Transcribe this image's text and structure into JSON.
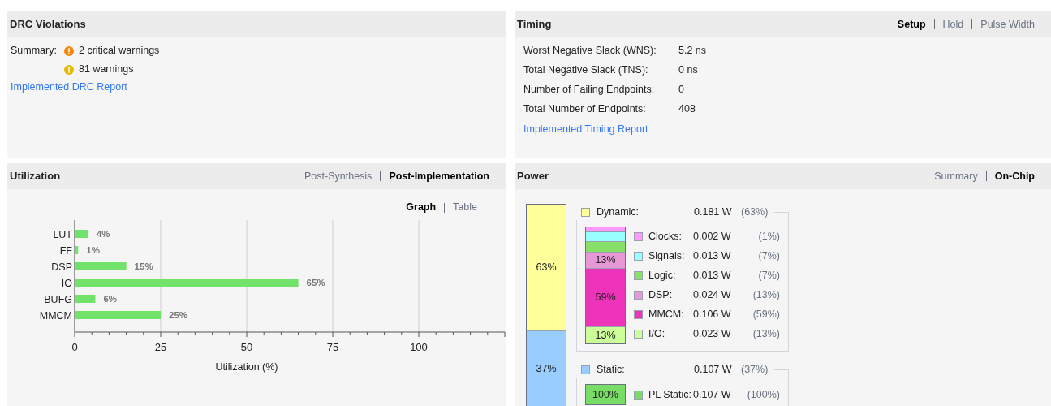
{
  "drc": {
    "title": "DRC Violations",
    "summary_label": "Summary:",
    "items": [
      {
        "kind": "critical",
        "text": "2 critical warnings"
      },
      {
        "kind": "warning",
        "text": "81 warnings"
      }
    ],
    "link": "Implemented DRC Report"
  },
  "timing": {
    "title": "Timing",
    "tabs": [
      {
        "label": "Setup",
        "selected": true
      },
      {
        "label": "Hold",
        "selected": false
      },
      {
        "label": "Pulse Width",
        "selected": false
      }
    ],
    "rows": [
      {
        "label": "Worst Negative Slack (WNS):",
        "value": "5.2 ns"
      },
      {
        "label": "Total Negative Slack (TNS):",
        "value": "0 ns"
      },
      {
        "label": "Number of Failing Endpoints:",
        "value": "0"
      },
      {
        "label": "Total Number of Endpoints:",
        "value": "408"
      }
    ],
    "link": "Implemented Timing Report"
  },
  "utilization": {
    "title": "Utilization",
    "tabs": [
      {
        "label": "Post-Synthesis",
        "selected": false
      },
      {
        "label": "Post-Implementation",
        "selected": true
      }
    ],
    "view_tabs": [
      {
        "label": "Graph",
        "selected": true
      },
      {
        "label": "Table",
        "selected": false
      }
    ],
    "chart_data": {
      "type": "bar",
      "orientation": "horizontal",
      "xlabel": "Utilization (%)",
      "categories": [
        "LUT",
        "FF",
        "DSP",
        "IO",
        "BUFG",
        "MMCM"
      ],
      "series": [
        {
          "color": "#72e36a",
          "values": [
            4,
            1,
            15,
            65,
            6,
            25
          ]
        }
      ],
      "grid": true,
      "xlim": [
        0,
        125
      ],
      "xticks": [
        0,
        25,
        50,
        75,
        100
      ],
      "value_labels": [
        "4%",
        "1%",
        "15%",
        "65%",
        "6%",
        "25%"
      ]
    }
  },
  "power": {
    "title": "Power",
    "tabs": [
      {
        "label": "Summary",
        "selected": false
      },
      {
        "label": "On-Chip",
        "selected": true
      }
    ],
    "groups": [
      {
        "label": "Dynamic:",
        "watts": "0.181 W",
        "percent": "(63%)",
        "color": "#ffff99",
        "bar_label": "63%",
        "items": [
          {
            "label": "Clocks:",
            "watts": "0.002 W",
            "percent": "(1%)",
            "color": "#ff99ff"
          },
          {
            "label": "Signals:",
            "watts": "0.013 W",
            "percent": "(7%)",
            "color": "#99ffff"
          },
          {
            "label": "Logic:",
            "watts": "0.013 W",
            "percent": "(7%)",
            "color": "#88e068"
          },
          {
            "label": "DSP:",
            "watts": "0.024 W",
            "percent": "(13%)",
            "color": "#e699d6",
            "bar_label": "13%"
          },
          {
            "label": "MMCM:",
            "watts": "0.106 W",
            "percent": "(59%)",
            "color": "#ee33bb",
            "bar_label": "59%"
          },
          {
            "label": "I/O:",
            "watts": "0.023 W",
            "percent": "(13%)",
            "color": "#ccff99",
            "bar_label": "13%"
          }
        ]
      },
      {
        "label": "Static:",
        "watts": "0.107 W",
        "percent": "(37%)",
        "color": "#99ccff",
        "bar_label": "37%",
        "items": [
          {
            "label": "PL Static:",
            "watts": "0.107 W",
            "percent": "(100%)",
            "color": "#77dd66",
            "bar_label": "100%"
          }
        ]
      }
    ]
  }
}
